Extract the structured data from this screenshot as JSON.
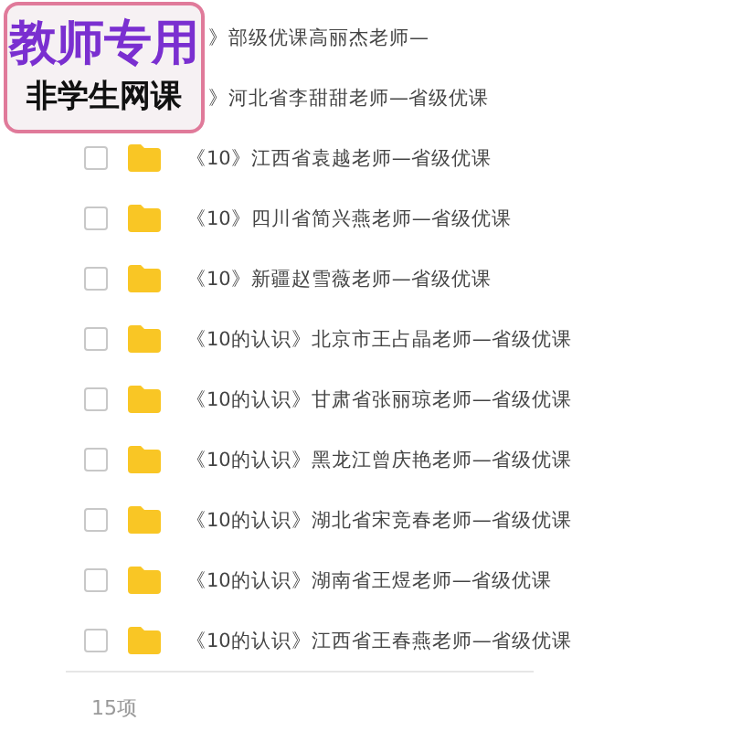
{
  "badge": {
    "title": "教师专用",
    "subtitle": "非学生网课"
  },
  "files": [
    {
      "kind": "partial",
      "name": "》部级优课高丽杰老师—"
    },
    {
      "kind": "partial",
      "name": "》河北省李甜甜老师—省级优课"
    },
    {
      "kind": "folder",
      "name": "《10》江西省袁越老师—省级优课",
      "checked": false
    },
    {
      "kind": "folder",
      "name": "《10》四川省简兴燕老师—省级优课",
      "checked": false
    },
    {
      "kind": "folder",
      "name": "《10》新疆赵雪薇老师—省级优课",
      "checked": false
    },
    {
      "kind": "folder",
      "name": "《10的认识》北京市王占晶老师—省级优课",
      "checked": false
    },
    {
      "kind": "folder",
      "name": "《10的认识》甘肃省张丽琼老师—省级优课",
      "checked": false
    },
    {
      "kind": "folder",
      "name": "《10的认识》黑龙江曾庆艳老师—省级优课",
      "checked": false
    },
    {
      "kind": "folder",
      "name": "《10的认识》湖北省宋竞春老师—省级优课",
      "checked": false
    },
    {
      "kind": "folder",
      "name": "《10的认识》湖南省王煜老师—省级优课",
      "checked": false
    },
    {
      "kind": "folder",
      "name": "《10的认识》江西省王春燕老师—省级优课",
      "checked": false
    }
  ],
  "footer": {
    "count": "15项"
  }
}
